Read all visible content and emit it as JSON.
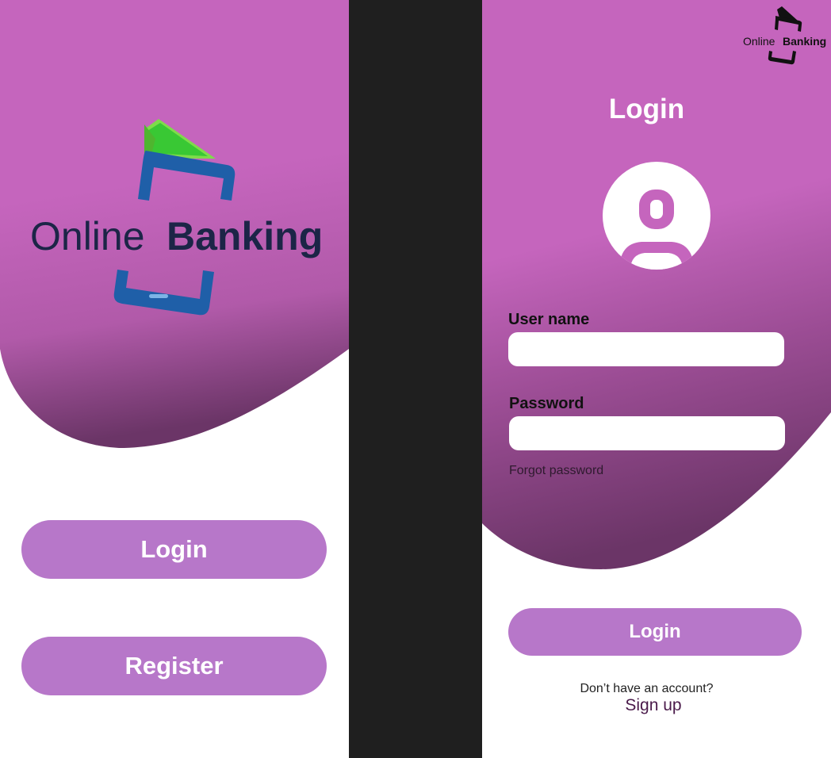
{
  "splash": {
    "logo": {
      "word1": "Online",
      "word2": "Banking"
    },
    "login_label": "Login",
    "register_label": "Register"
  },
  "login": {
    "logo": {
      "word1": "Online",
      "word2": "Banking"
    },
    "title": "Login",
    "username_label": "User name",
    "username_value": "",
    "password_label": "Password",
    "password_value": "",
    "forgot_password": "Forgot password",
    "login_label": "Login",
    "no_account_text": "Don’t have an account?",
    "sign_up": "Sign up"
  },
  "colors": {
    "blob_primary": "#c565bd",
    "blob_shadow": "#6b3567",
    "button": "#b777c9",
    "divider": "#1f1f1f",
    "logo_green": "#39c834",
    "logo_blue": "#1f5fa8",
    "logo_navy": "#1c2547"
  },
  "icons": {
    "avatar": "user-avatar-icon",
    "splash_logo": "online-banking-logo",
    "corner_logo": "online-banking-logo-small"
  }
}
